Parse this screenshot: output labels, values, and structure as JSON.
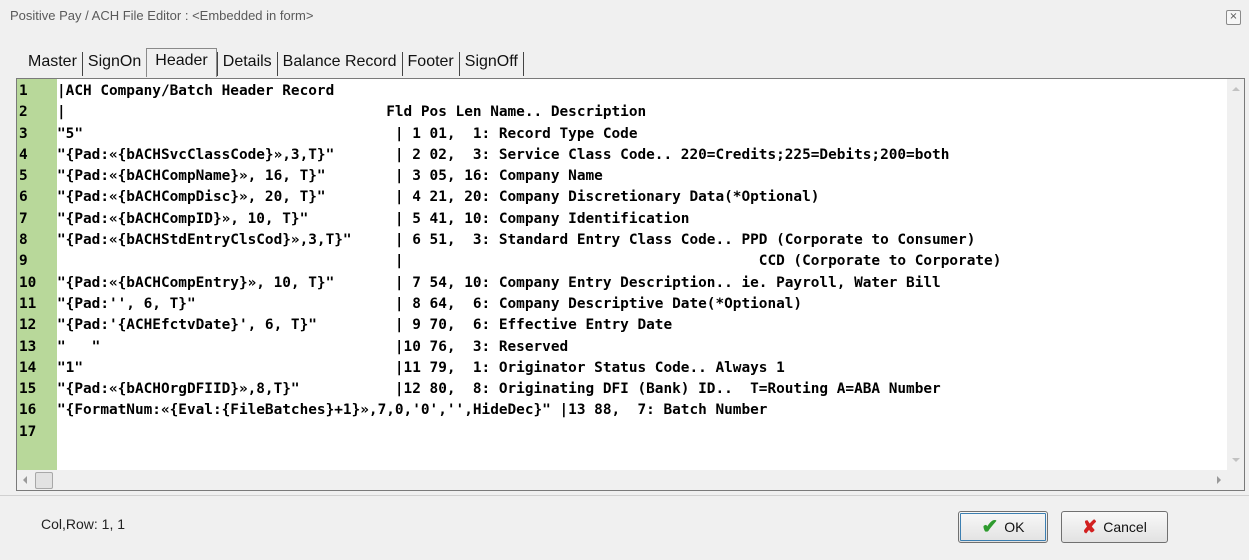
{
  "window": {
    "title": "Positive Pay / ACH File  Editor : <Embedded in form>",
    "close_glyph": "×"
  },
  "tabs": [
    {
      "label": "Master",
      "active": false
    },
    {
      "label": "SignOn",
      "active": false
    },
    {
      "label": "Header",
      "active": true
    },
    {
      "label": "Details",
      "active": false
    },
    {
      "label": "Balance Record",
      "active": false
    },
    {
      "label": "Footer",
      "active": false
    },
    {
      "label": "SignOff",
      "active": false
    }
  ],
  "editor": {
    "gutter_color": "#b8d89a",
    "lines": [
      {
        "n": "1",
        "text": "|ACH Company/Batch Header Record"
      },
      {
        "n": "2",
        "text": "|                                     Fld Pos Len Name.. Description"
      },
      {
        "n": "3",
        "text": "\"5\"                                    | 1 01,  1: Record Type Code"
      },
      {
        "n": "4",
        "text": "\"{Pad:«{bACHSvcClassCode}»,3,T}\"       | 2 02,  3: Service Class Code.. 220=Credits;225=Debits;200=both"
      },
      {
        "n": "5",
        "text": "\"{Pad:«{bACHCompName}», 16, T}\"        | 3 05, 16: Company Name"
      },
      {
        "n": "6",
        "text": "\"{Pad:«{bACHCompDisc}», 20, T}\"        | 4 21, 20: Company Discretionary Data(*Optional)"
      },
      {
        "n": "7",
        "text": "\"{Pad:«{bACHCompID}», 10, T}\"          | 5 41, 10: Company Identification"
      },
      {
        "n": "8",
        "text": "\"{Pad:«{bACHStdEntryClsCod}»,3,T}\"     | 6 51,  3: Standard Entry Class Code.. PPD (Corporate to Consumer)"
      },
      {
        "n": "9",
        "text": "                                       |                                         CCD (Corporate to Corporate)"
      },
      {
        "n": "10",
        "text": "\"{Pad:«{bACHCompEntry}», 10, T}\"       | 7 54, 10: Company Entry Description.. ie. Payroll, Water Bill"
      },
      {
        "n": "11",
        "text": "\"{Pad:'', 6, T}\"                       | 8 64,  6: Company Descriptive Date(*Optional)"
      },
      {
        "n": "12",
        "text": "\"{Pad:'{ACHEfctvDate}', 6, T}\"         | 9 70,  6: Effective Entry Date"
      },
      {
        "n": "13",
        "text": "\"   \"                                  |10 76,  3: Reserved"
      },
      {
        "n": "14",
        "text": "\"1\"                                    |11 79,  1: Originator Status Code.. Always 1"
      },
      {
        "n": "15",
        "text": "\"{Pad:«{bACHOrgDFIID}»,8,T}\"           |12 80,  8: Originating DFI (Bank) ID..  T=Routing A=ABA Number"
      },
      {
        "n": "16",
        "text": "\"{FormatNum:«{Eval:{FileBatches}+1}»,7,0,'0','',HideDec}\" |13 88,  7: Batch Number"
      },
      {
        "n": "17",
        "text": ""
      }
    ]
  },
  "status": {
    "text": "Col,Row: 1, 1"
  },
  "buttons": {
    "ok_label": "OK",
    "cancel_label": "Cancel"
  }
}
